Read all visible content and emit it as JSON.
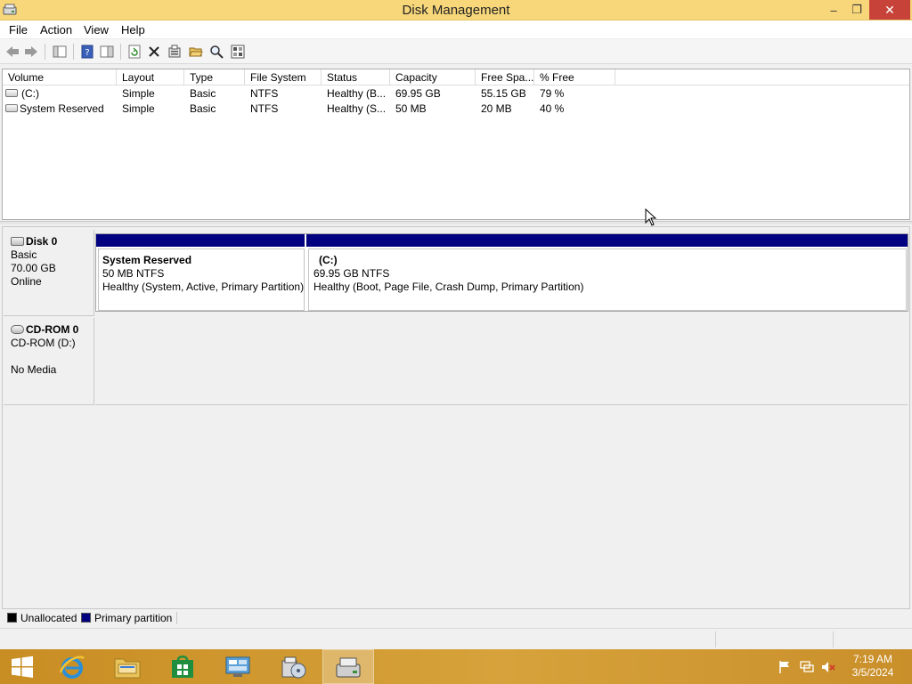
{
  "window": {
    "title": "Disk Management",
    "minimize_glyph": "–",
    "maximize_glyph": "❐",
    "close_glyph": "✕"
  },
  "menu": {
    "items": [
      "File",
      "Action",
      "View",
      "Help"
    ]
  },
  "toolbar": {
    "icons": [
      "back-arrow-icon",
      "forward-arrow-icon",
      "show-hide-console-tree-icon",
      "help-icon",
      "properties-pane-icon",
      "refresh-icon",
      "delete-icon",
      "properties-icon",
      "open-icon",
      "explore-icon",
      "settings-icon"
    ]
  },
  "volume_list": {
    "columns": [
      "Volume",
      "Layout",
      "Type",
      "File System",
      "Status",
      "Capacity",
      "Free Spa...",
      "% Free"
    ],
    "rows": [
      {
        "volume": "(C:)",
        "layout": "Simple",
        "type": "Basic",
        "fs": "NTFS",
        "status": "Healthy (B...",
        "capacity": "69.95 GB",
        "free": "55.15 GB",
        "pct_free": "79 %"
      },
      {
        "volume": "System Reserved",
        "layout": "Simple",
        "type": "Basic",
        "fs": "NTFS",
        "status": "Healthy (S...",
        "capacity": "50 MB",
        "free": "20 MB",
        "pct_free": "40 %"
      }
    ]
  },
  "disks": {
    "disk0": {
      "name": "Disk 0",
      "type": "Basic",
      "size": "70.00 GB",
      "state": "Online",
      "partitions": [
        {
          "name": "System Reserved",
          "size_fs": "50 MB NTFS",
          "status": "Healthy (System, Active, Primary Partition)"
        },
        {
          "name": "(C:)",
          "size_fs": "69.95 GB NTFS",
          "status": "Healthy (Boot, Page File, Crash Dump, Primary Partition)"
        }
      ]
    },
    "cdrom0": {
      "name": "CD-ROM 0",
      "drive": "CD-ROM (D:)",
      "media": "No Media"
    }
  },
  "legend": {
    "unallocated": "Unallocated",
    "primary": "Primary partition",
    "unallocated_color": "#000000",
    "primary_color": "#000080"
  },
  "taskbar": {
    "apps": [
      "start-icon",
      "internet-explorer-icon",
      "file-explorer-icon",
      "store-icon",
      "server-manager-icon",
      "disk-tools-icon",
      "disk-management-icon"
    ],
    "time": "7:19 AM",
    "date": "3/5/2024"
  },
  "colors": {
    "titlebar": "#f7d77a",
    "taskbar": "#d7a23b",
    "partition_bar": "#000080"
  }
}
